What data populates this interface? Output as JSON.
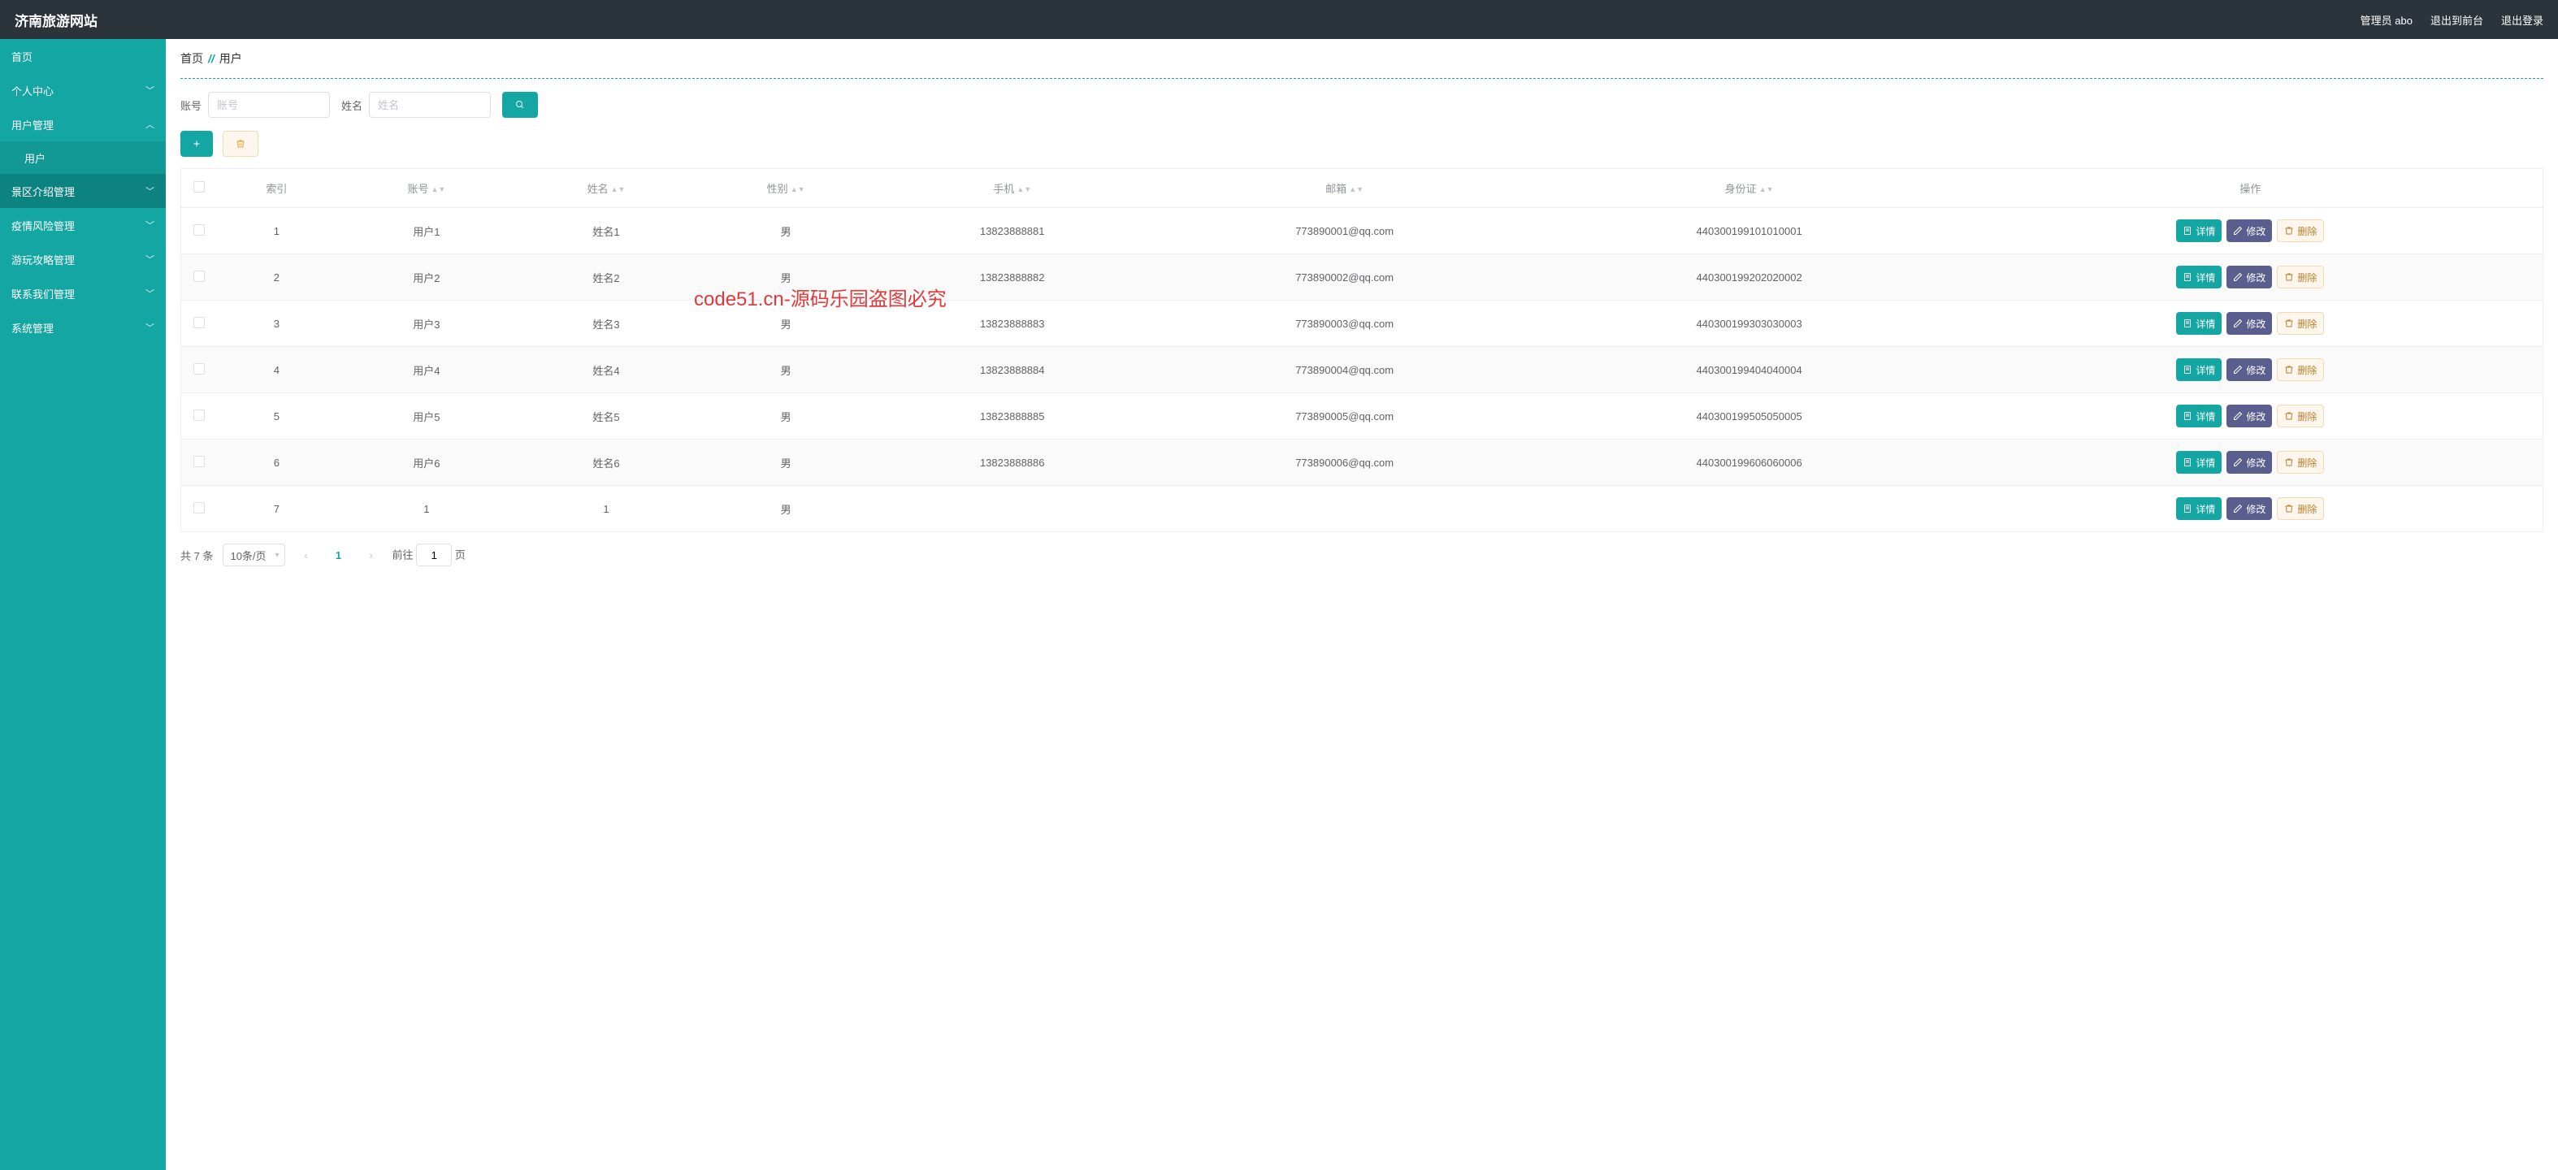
{
  "header": {
    "brand": "济南旅游网站",
    "admin_label": "管理员 abo",
    "to_front_label": "退出到前台",
    "logout_label": "退出登录"
  },
  "sidebar": {
    "home": "首页",
    "items": [
      {
        "label": "个人中心",
        "expandable": true
      },
      {
        "label": "用户管理",
        "expandable": true,
        "open": true,
        "children": [
          {
            "label": "用户"
          }
        ]
      },
      {
        "label": "景区介绍管理",
        "expandable": true
      },
      {
        "label": "疫情风险管理",
        "expandable": true
      },
      {
        "label": "游玩攻略管理",
        "expandable": true
      },
      {
        "label": "联系我们管理",
        "expandable": true
      },
      {
        "label": "系统管理",
        "expandable": true
      }
    ]
  },
  "breadcrumb": {
    "root": "首页",
    "current": "用户"
  },
  "filter": {
    "account_label": "账号",
    "account_placeholder": "账号",
    "name_label": "姓名",
    "name_placeholder": "姓名"
  },
  "table": {
    "columns": {
      "index": "索引",
      "account": "账号",
      "name": "姓名",
      "gender": "性别",
      "phone": "手机",
      "email": "邮箱",
      "idcard": "身份证",
      "actions": "操作"
    },
    "action_labels": {
      "detail": "详情",
      "edit": "修改",
      "delete": "删除"
    },
    "rows": [
      {
        "index": "1",
        "account": "用户1",
        "name": "姓名1",
        "gender": "男",
        "phone": "13823888881",
        "email": "773890001@qq.com",
        "idcard": "440300199101010001"
      },
      {
        "index": "2",
        "account": "用户2",
        "name": "姓名2",
        "gender": "男",
        "phone": "13823888882",
        "email": "773890002@qq.com",
        "idcard": "440300199202020002"
      },
      {
        "index": "3",
        "account": "用户3",
        "name": "姓名3",
        "gender": "男",
        "phone": "13823888883",
        "email": "773890003@qq.com",
        "idcard": "440300199303030003"
      },
      {
        "index": "4",
        "account": "用户4",
        "name": "姓名4",
        "gender": "男",
        "phone": "13823888884",
        "email": "773890004@qq.com",
        "idcard": "440300199404040004"
      },
      {
        "index": "5",
        "account": "用户5",
        "name": "姓名5",
        "gender": "男",
        "phone": "13823888885",
        "email": "773890005@qq.com",
        "idcard": "440300199505050005"
      },
      {
        "index": "6",
        "account": "用户6",
        "name": "姓名6",
        "gender": "男",
        "phone": "13823888886",
        "email": "773890006@qq.com",
        "idcard": "440300199606060006"
      },
      {
        "index": "7",
        "account": "1",
        "name": "1",
        "gender": "男",
        "phone": "",
        "email": "",
        "idcard": ""
      }
    ]
  },
  "pagination": {
    "total_label": "共 7 条",
    "per_page": "10条/页",
    "current": "1",
    "jump_prefix": "前往",
    "jump_value": "1",
    "jump_suffix": "页"
  },
  "watermark": {
    "text": "code51.cn",
    "red_text": "code51.cn-源码乐园盗图必究"
  }
}
